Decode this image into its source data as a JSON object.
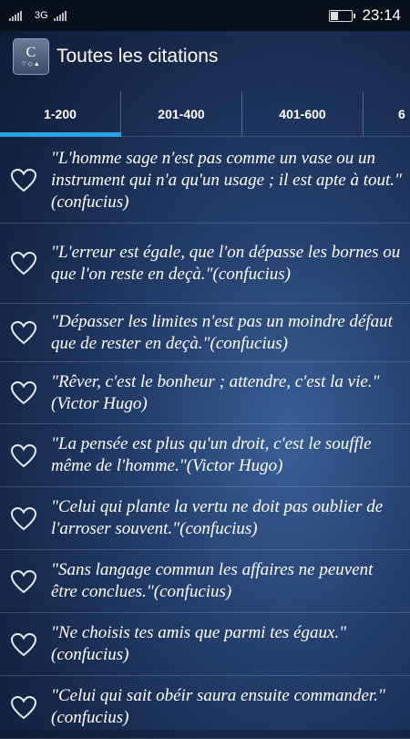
{
  "statusbar": {
    "network": "3G",
    "time": "23:14",
    "battery_level": 0.4
  },
  "app": {
    "title": "Toutes les citations",
    "icon_letter": "C",
    "icon_symbols": "♡◇▲"
  },
  "tabs": [
    {
      "label": "1-200",
      "active": true
    },
    {
      "label": "201-400",
      "active": false
    },
    {
      "label": "401-600",
      "active": false
    },
    {
      "label": "6",
      "active": false
    }
  ],
  "quotes": [
    "\"L'homme sage n'est pas comme un vase ou un instrument qui n'a qu'un usage ; il est apte à tout.\"(confucius)",
    "\"L'erreur est égale, que l'on dépasse les bornes ou que l'on reste en deçà.\"(confucius)",
    "\"Dépasser les limites n'est pas un moindre défaut que de rester en deçà.\"(confucius)",
    "\"Rêver, c'est le bonheur ; attendre, c'est la vie.\"(Victor Hugo)",
    "\"La pensée est plus qu'un droit, c'est le souffle même de l'homme.\"(Victor Hugo)",
    "\"Celui qui plante la vertu ne doit pas oublier de l'arroser souvent.\"(confucius)",
    "\"Sans langage commun les affaires ne peuvent être conclues.\"(confucius)",
    "\"Ne choisis tes amis que parmi tes égaux.\"(confucius)",
    "\"Celui qui sait obéir saura ensuite commander.\"(confucius)"
  ],
  "colors": {
    "accent": "#29a3e0",
    "statusbar": "#0a0f1c"
  }
}
